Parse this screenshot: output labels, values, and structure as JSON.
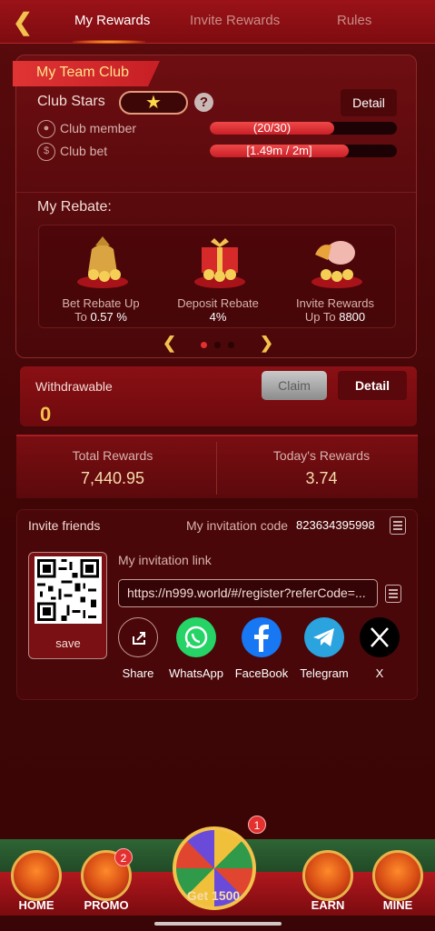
{
  "tabs": [
    {
      "label": "My Rewards"
    },
    {
      "label": "Invite Rewards"
    },
    {
      "label": "Rules"
    }
  ],
  "club": {
    "ribbon": "My Team Club",
    "stars_label": "Club Stars",
    "detail": "Detail",
    "member_label": "Club member",
    "member_value": "(20/30)",
    "member_progress": 0.667,
    "bet_label": "Club bet",
    "bet_value": "[1.49m / 2m]",
    "bet_progress": 0.745
  },
  "rebate": {
    "title": "My Rebate:",
    "items": [
      {
        "line1": "Bet Rebate Up",
        "prefix": "To",
        "value": "0.57 %"
      },
      {
        "line1": "Deposit Rebate",
        "prefix": "",
        "value": "4%"
      },
      {
        "line1": "Invite Rewards",
        "prefix": "Up To",
        "value": "8800"
      }
    ],
    "active_page": 1,
    "pages": 3
  },
  "withdraw": {
    "label": "Withdrawable",
    "value": "0",
    "claim": "Claim",
    "detail": "Detail"
  },
  "totals": {
    "total_label": "Total Rewards",
    "total_value": "7,440.95",
    "today_label": "Today's Rewards",
    "today_value": "3.74"
  },
  "invite": {
    "title": "Invite friends",
    "code_label": "My invitation code",
    "code": "823634395998",
    "qr_save": "save",
    "link_label": "My invitation link",
    "link": "https://n999.world/#/register?referCode=...",
    "share": [
      {
        "label": "Share",
        "color": "#3d0708"
      },
      {
        "label": "WhatsApp",
        "color": "#25d366"
      },
      {
        "label": "FaceBook",
        "color": "#1877f2"
      },
      {
        "label": "Telegram",
        "color": "#2aa3df"
      },
      {
        "label": "X",
        "color": "#000000"
      }
    ]
  },
  "nav": {
    "home": "HOME",
    "promo": "PROMO",
    "promo_badge": "2",
    "spin": "Get 1500",
    "spin_badge": "1",
    "earn": "EARN",
    "mine": "MINE"
  }
}
